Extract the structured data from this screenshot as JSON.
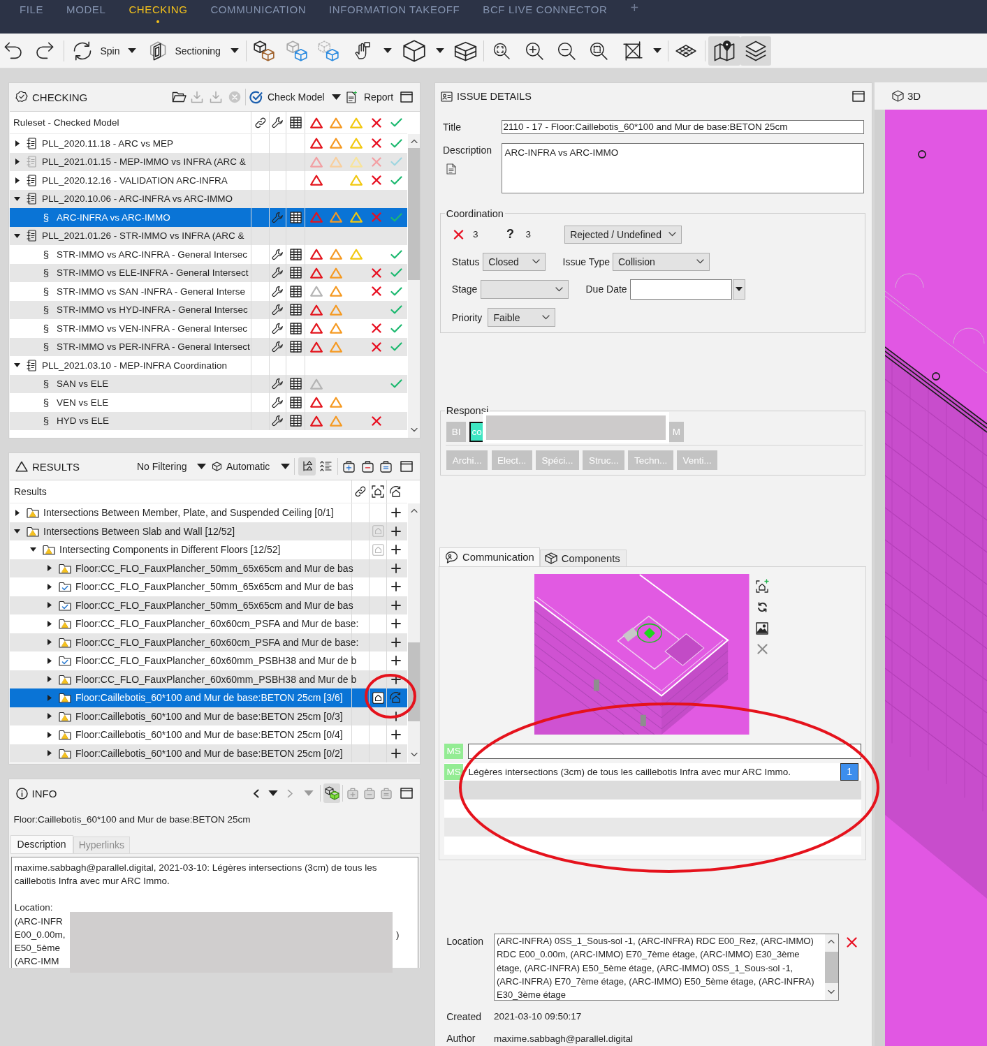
{
  "menu": [
    {
      "label": "FILE",
      "selected": false
    },
    {
      "label": "MODEL",
      "selected": false
    },
    {
      "label": "CHECKING",
      "selected": true
    },
    {
      "label": "COMMUNICATION",
      "selected": false
    },
    {
      "label": "INFORMATION TAKEOFF",
      "selected": false
    },
    {
      "label": "BCF LIVE CONNECTOR",
      "selected": false
    }
  ],
  "menu_add": "+",
  "toolbar": [
    {
      "pressed": false
    },
    {
      "pressed": false
    },
    {
      "label": "Spin",
      "pressed": false
    },
    {
      "label": "Sectioning",
      "pressed": false
    },
    {
      "pressed": false
    },
    {
      "pressed": false
    },
    {
      "pressed": false
    },
    {
      "pressed": false
    },
    {
      "pressed": false
    },
    {
      "pressed": false
    },
    {
      "pressed": false
    },
    {
      "pressed": false
    },
    {
      "pressed": false
    },
    {
      "pressed": false
    },
    {
      "pressed": false
    },
    {
      "pressed": false
    },
    {
      "pressed": true
    },
    {
      "pressed": true
    }
  ],
  "checking": {
    "title": "CHECKING",
    "tools": [
      {
        "disabled": false
      },
      {
        "disabled": true
      },
      {
        "disabled": true
      },
      {
        "disabled": true
      }
    ],
    "check_button": "Check Model",
    "report_button": "Report",
    "column_header": "Ruleset - Checked Model",
    "rows": [
      {
        "kind": "ruleset",
        "label": "PLL_2020.11.18 - ARC vs MEP",
        "expanded": false,
        "selected": false,
        "disabled": false,
        "marks": [
          {
            "kind": "critical",
            "grayed": false
          },
          {
            "kind": "major",
            "grayed": false
          },
          {
            "kind": "minor",
            "grayed": false
          },
          {
            "kind": "rejected",
            "grayed": false
          },
          {
            "kind": "approved",
            "grayed": false
          }
        ]
      },
      {
        "kind": "ruleset",
        "label": "PLL_2021.01.15 - MEP-IMMO vs INFRA (ARC &",
        "expanded": false,
        "selected": false,
        "disabled": true,
        "marks": [
          {
            "kind": "critical",
            "grayed": false
          },
          {
            "kind": "major",
            "grayed": false
          },
          {
            "kind": "minor",
            "grayed": false
          },
          {
            "kind": "rejected",
            "grayed": false
          },
          {
            "kind": "approved",
            "grayed": false
          }
        ]
      },
      {
        "kind": "ruleset",
        "label": "PLL_2020.12.16 - VALIDATION ARC-INFRA",
        "expanded": false,
        "selected": false,
        "disabled": false,
        "marks": [
          {
            "kind": "critical",
            "grayed": false
          },
          {
            "kind": "minor",
            "grayed": false
          },
          {
            "kind": "rejected",
            "grayed": false
          },
          {
            "kind": "approved",
            "grayed": false
          }
        ]
      },
      {
        "kind": "ruleset",
        "label": "PLL_2020.10.06 - ARC-INFRA vs ARC-IMMO",
        "expanded": true,
        "selected": false,
        "disabled": false,
        "children": [
          {
            "kind": "rule",
            "mark": "§",
            "label": "ARC-INFRA vs ARC-IMMO",
            "selected": true,
            "disabled": false,
            "marks": [
              {
                "kind": "critical",
                "grayed": false
              },
              {
                "kind": "major",
                "grayed": false
              },
              {
                "kind": "minor",
                "grayed": false
              },
              {
                "kind": "rejected",
                "grayed": false
              },
              {
                "kind": "approved",
                "grayed": false
              }
            ]
          }
        ]
      },
      {
        "kind": "ruleset",
        "label": "PLL_2021.01.26 - STR-IMMO vs INFRA (ARC &",
        "expanded": true,
        "selected": false,
        "disabled": false,
        "children": [
          {
            "kind": "rule",
            "mark": "§",
            "label": "STR-IMMO vs ARC-INFRA - General Intersec",
            "selected": false,
            "disabled": false,
            "marks": [
              {
                "kind": "critical",
                "grayed": false
              },
              {
                "kind": "major",
                "grayed": false
              },
              {
                "kind": "minor",
                "grayed": false
              },
              {
                "kind": "approved",
                "grayed": false
              }
            ]
          },
          {
            "kind": "rule",
            "mark": "§",
            "label": "STR-IMMO vs ELE-INFRA - General Intersect",
            "selected": false,
            "disabled": false,
            "marks": [
              {
                "kind": "critical",
                "grayed": false
              },
              {
                "kind": "major",
                "grayed": false
              },
              {
                "kind": "rejected",
                "grayed": false
              },
              {
                "kind": "approved",
                "grayed": false
              }
            ]
          },
          {
            "kind": "rule",
            "mark": "§",
            "label": "STR-IMMO vs SAN -INFRA - General Interse",
            "selected": false,
            "disabled": false,
            "marks": [
              {
                "kind": "critical",
                "grayed": true
              },
              {
                "kind": "major",
                "grayed": false
              },
              {
                "kind": "rejected",
                "grayed": false
              },
              {
                "kind": "approved",
                "grayed": false
              }
            ]
          },
          {
            "kind": "rule",
            "mark": "§",
            "label": "STR-IMMO vs HYD-INFRA - General Intersec",
            "selected": false,
            "disabled": false,
            "marks": [
              {
                "kind": "critical",
                "grayed": false
              },
              {
                "kind": "major",
                "grayed": false
              },
              {
                "kind": "approved",
                "grayed": false
              }
            ]
          },
          {
            "kind": "rule",
            "mark": "§",
            "label": "STR-IMMO vs VEN-INFRA - General Intersec",
            "selected": false,
            "disabled": false,
            "marks": [
              {
                "kind": "critical",
                "grayed": false
              },
              {
                "kind": "major",
                "grayed": false
              },
              {
                "kind": "rejected",
                "grayed": false
              },
              {
                "kind": "approved",
                "grayed": false
              }
            ]
          },
          {
            "kind": "rule",
            "mark": "§",
            "label": "STR-IMMO vs PER-INFRA - General Intersect",
            "selected": false,
            "disabled": false,
            "marks": [
              {
                "kind": "critical",
                "grayed": false
              },
              {
                "kind": "major",
                "grayed": false
              },
              {
                "kind": "rejected",
                "grayed": false
              },
              {
                "kind": "approved",
                "grayed": false
              }
            ]
          }
        ]
      },
      {
        "kind": "ruleset",
        "label": "PLL_2021.03.10 - MEP-INFRA Coordination",
        "expanded": true,
        "selected": false,
        "disabled": false,
        "children": [
          {
            "kind": "rule",
            "mark": "§",
            "label": "SAN vs ELE",
            "selected": false,
            "disabled": false,
            "marks": [
              {
                "kind": "critical",
                "grayed": true
              },
              {
                "kind": "approved",
                "grayed": false
              }
            ]
          },
          {
            "kind": "rule",
            "mark": "§",
            "label": "VEN vs ELE",
            "selected": false,
            "disabled": false,
            "marks": [
              {
                "kind": "critical",
                "grayed": false
              },
              {
                "kind": "major",
                "grayed": false
              }
            ]
          },
          {
            "kind": "rule",
            "mark": "§",
            "label": "HYD vs ELE",
            "selected": false,
            "disabled": false,
            "marks": [
              {
                "kind": "critical",
                "grayed": false
              },
              {
                "kind": "major",
                "grayed": false
              },
              {
                "kind": "rejected",
                "grayed": false
              }
            ]
          }
        ]
      }
    ]
  },
  "results": {
    "title": "RESULTS",
    "filter": "No Filtering",
    "mode": "Automatic",
    "views": [
      {
        "pressed": true
      },
      {
        "pressed": false
      }
    ],
    "column_header": "Results",
    "rows": [
      {
        "approved": false,
        "label": "Intersections Between Member, Plate, and Suspended Ceiling [0/1]",
        "expanded": false,
        "selected": false,
        "viewpoint": false,
        "viewpoint_active": false
      },
      {
        "approved": false,
        "label": "Intersections Between Slab and Wall [12/52]",
        "expanded": true,
        "selected": false,
        "viewpoint": true,
        "viewpoint_active": false,
        "children": [
          {
            "approved": false,
            "label": "Intersecting Components in Different Floors [12/52]",
            "expanded": true,
            "selected": false,
            "viewpoint": true,
            "viewpoint_active": false,
            "children": [
              {
                "approved": false,
                "label": "Floor:CC_FLO_FauxPlancher_50mm_65x65cm and Mur de bas",
                "expanded": false,
                "selected": false,
                "viewpoint": false,
                "viewpoint_active": false
              },
              {
                "approved": true,
                "label": "Floor:CC_FLO_FauxPlancher_50mm_65x65cm and Mur de bas",
                "expanded": false,
                "selected": false,
                "viewpoint": false,
                "viewpoint_active": false
              },
              {
                "approved": true,
                "label": "Floor:CC_FLO_FauxPlancher_50mm_65x65cm and Mur de bas",
                "expanded": false,
                "selected": false,
                "viewpoint": false,
                "viewpoint_active": false
              },
              {
                "approved": false,
                "label": "Floor:CC_FLO_FauxPlancher_60x60cm_PSFA and Mur de base:",
                "expanded": false,
                "selected": false,
                "viewpoint": false,
                "viewpoint_active": false
              },
              {
                "approved": false,
                "label": "Floor:CC_FLO_FauxPlancher_60x60cm_PSFA and Mur de base:",
                "expanded": false,
                "selected": false,
                "viewpoint": false,
                "viewpoint_active": false
              },
              {
                "approved": true,
                "label": "Floor:CC_FLO_FauxPlancher_60x60mm_PSBH38 and Mur de b",
                "expanded": false,
                "selected": false,
                "viewpoint": false,
                "viewpoint_active": false
              },
              {
                "approved": false,
                "label": "Floor:CC_FLO_FauxPlancher_60x60mm_PSBH38 and Mur de b",
                "expanded": false,
                "selected": false,
                "viewpoint": false,
                "viewpoint_active": false
              },
              {
                "approved": false,
                "label": "Floor:Caillebotis_60*100 and Mur de base:BETON 25cm [3/6]",
                "expanded": false,
                "selected": true,
                "viewpoint": true,
                "viewpoint_active": true
              },
              {
                "approved": false,
                "label": "Floor:Caillebotis_60*100 and Mur de base:BETON 25cm [0/3]",
                "expanded": false,
                "selected": false,
                "viewpoint": false,
                "viewpoint_active": false
              },
              {
                "approved": false,
                "label": "Floor:Caillebotis_60*100 and Mur de base:BETON 25cm [0/4]",
                "expanded": false,
                "selected": false,
                "viewpoint": false,
                "viewpoint_active": false
              },
              {
                "approved": false,
                "label": "Floor:Caillebotis_60*100 and Mur de base:BETON 25cm [0/2]",
                "expanded": false,
                "selected": false,
                "viewpoint": false,
                "viewpoint_active": false
              }
            ]
          }
        ]
      }
    ]
  },
  "info": {
    "title": "INFO",
    "nav": [
      {
        "disabled": false
      },
      {
        "disabled": false
      },
      {
        "disabled": true
      },
      {
        "disabled": true
      }
    ],
    "model_button": {
      "pressed": true
    },
    "bags": [
      {
        "disabled": true
      },
      {
        "disabled": true
      },
      {
        "disabled": true
      }
    ],
    "subject": "Floor:Caillebotis_60*100 and Mur de base:BETON 25cm",
    "tabs": [
      {
        "label": "Description",
        "selected": true
      },
      {
        "label": "Hyperlinks",
        "selected": false
      }
    ],
    "description": "maxime.sabbagh@parallel.digital, 2021-03-10: Légères intersections (3cm) de tous les caillebotis Infra avec mur ARC Immo.",
    "location_label": "Location:",
    "location_lines": [
      "(ARC-INFR",
      "E00_0.00m,",
      "E50_5ème",
      "(ARC-IMM"
    ],
    "location_end": ")"
  },
  "issue": {
    "title": "ISSUE DETAILS",
    "title_label": "Title",
    "title_value": "2110 - 17 - Floor:Caillebotis_60*100 and Mur de base:BETON 25cm",
    "description_label": "Description",
    "description_value": "ARC-INFRA vs ARC-IMMO",
    "coordination": {
      "legend": "Coordination",
      "rejected_count": "3",
      "unknown_symbol": "?",
      "unknown_count": "3",
      "resolution": "Rejected / Undefined",
      "status_label": "Status",
      "status": "Closed",
      "type_label": "Issue Type",
      "type": "Collision",
      "stage_label": "Stage",
      "due_label": "Due Date",
      "priority_label": "Priority",
      "priority": "Faible"
    },
    "responsibilities": {
      "legend": "Responsi",
      "labels": [
        {
          "kind": "label",
          "text": "BI",
          "selected": false
        },
        {
          "kind": "label",
          "text": "co",
          "selected": true
        },
        {
          "kind": "redacted"
        },
        {
          "kind": "label",
          "text": "M",
          "selected": false
        }
      ],
      "categories": [
        {
          "text": "Archi...",
          "selected": false
        },
        {
          "text": "Elect...",
          "selected": false
        },
        {
          "text": "Spéci...",
          "selected": false
        },
        {
          "text": "Struc...",
          "selected": false
        },
        {
          "text": "Techn...",
          "selected": false
        },
        {
          "text": "Venti...",
          "selected": false
        }
      ]
    },
    "tabs": [
      {
        "label": "Communication",
        "selected": true
      },
      {
        "label": "Components",
        "selected": false
      }
    ],
    "comment_draft": {
      "author": "MS"
    },
    "comments": [
      {
        "author": "MS",
        "text": "Légères intersections (3cm) de tous les caillebotis Infra avec mur ARC Immo.",
        "badge": "1"
      }
    ],
    "location_label": "Location",
    "location": "(ARC-INFRA) 0SS_1_Sous-sol -1, (ARC-INFRA) RDC E00_Rez, (ARC-IMMO) RDC E00_0.00m, (ARC-IMMO) E70_7ème étage, (ARC-IMMO) E30_3ème étage, (ARC-INFRA) E50_5ème étage, (ARC-IMMO) 0SS_1_Sous-sol -1, (ARC-INFRA) E70_7ème étage, (ARC-IMMO) E50_5ème étage, (ARC-INFRA) E30_3ème étage",
    "created_label": "Created",
    "created": "2021-03-10 09:50:17",
    "author_label": "Author",
    "author": "maxime.sabbagh@parallel.digital"
  },
  "view": {
    "tab": "3D"
  }
}
